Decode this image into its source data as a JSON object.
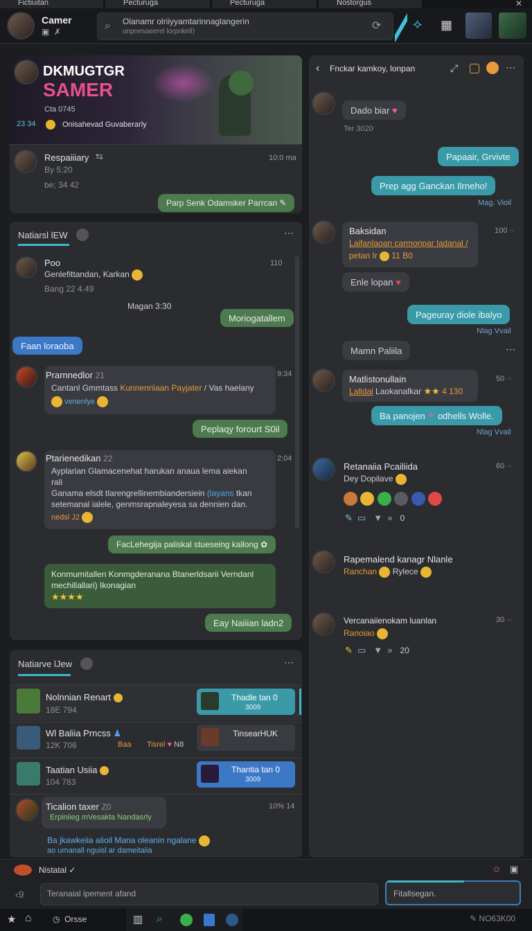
{
  "tabs": [
    "Fictiuitan",
    "Pecturuga",
    "Pecturuga",
    "Nostorgus"
  ],
  "header": {
    "username": "Camer",
    "search_text": "Olanamr olriiyyamtarinnaglangerin",
    "search_sub": "unpnesaeerel lorpnkell)"
  },
  "hero": {
    "title_line1": "DKMUGTGR",
    "title_line2": "SAMER",
    "stat1": "Cta  0745",
    "level": "23 34",
    "tagline": "Onisahevad Guvaberarly",
    "post_name": "Respaiiiary",
    "post_sub1": "By 5:20",
    "post_sub2": "be; 34 42",
    "post_time": "10:0 ma",
    "post_bubble": "Parp Senk Odamsker Parrcan"
  },
  "chat1": {
    "tab_label": "Natiarsl lEW",
    "messages": [
      {
        "name": "Poo",
        "text": "Genlefittandan, Karkan",
        "sub": "Bang 22 4.49",
        "time": "110"
      },
      {
        "divider": "Magan 3:30"
      },
      {
        "bubble_right": "Moriogatallem"
      },
      {
        "bubble_left": "Faan loraoba"
      },
      {
        "name": "Prarnnedlor",
        "badge": "21",
        "text_a": "Cantanl Gmmtass",
        "text_link": "Kunnenriiaan Payjater",
        "text_b": "/ Vas haelany",
        "text_c": "venenlye",
        "time": "9:34"
      },
      {
        "bubble_right": "Peplaqy forourt S0il"
      },
      {
        "name": "Ptarienedikan",
        "badge": "22",
        "line1": "Ayplarian Glamacenehat harukan anaua lema aiekan",
        "line2": "rali",
        "line3": "Ganama elsdt tlarengrellinembiandersiein",
        "line3_link": "(layans",
        "line3_b": "tkan",
        "line4": "setemanal ialele, genmsrapnaleyesa sa dennien dan.",
        "line5": "nedsl J2",
        "time": "2:04"
      },
      {
        "bubble_right": "FacLehegija paliskal stueseing kallong"
      },
      {
        "card_line1": "Konmumitallen Konmgderanana Btanerldsarii Verndanl",
        "card_line2": "mechillallari) Ikonagian"
      },
      {
        "bubble_right": "Eay Naiiian ladn2"
      }
    ]
  },
  "list_panel": {
    "tab_label": "Natiarve lJew",
    "rows": [
      {
        "title": "Nolnnian Renart",
        "sub": "18E 794",
        "card_title": "Thadle tan 0",
        "card_sub": "3009"
      },
      {
        "title": "Wl Baliia Prncss",
        "sub": "12K 706",
        "extra_a": "Baa",
        "extra_b": "Tisrel",
        "extra_c": "N8",
        "card_title": "TinsearHUK"
      },
      {
        "title": "Taatian Usiia",
        "sub": "104 783",
        "card_title": "Thantia tan 0",
        "card_sub": "3009"
      },
      {
        "title": "Ticalion taxer",
        "badge": "Z0",
        "sub": "Erpiniieg mVesakta Nandasrly",
        "time": "10% 14",
        "note1": "Ba jkawkeiia alioil Mana oleanin ngalane",
        "note2": "ao umanall nguisl ar dameitaiia"
      }
    ]
  },
  "right": {
    "header": "Fnckar kamkoy, lonpan",
    "messages": [
      {
        "bubble": "Dado biar",
        "sub": "Ter 3020"
      },
      {
        "bubble_right": "Papaair, Grvivte"
      },
      {
        "bubble_right": "Prep agg Ganckan Ilrneho!",
        "sub": "Mag. Vioil"
      },
      {
        "name": "Baksidan",
        "link": "Laifanlaoan carmonpar ladanal /",
        "link2": "petan Ir",
        "extra": "11 B0",
        "time": "100"
      },
      {
        "bubble": "Enle lopan"
      },
      {
        "bubble_right": "Pageuray diole ibalyo",
        "sub": "Nlag Vvail"
      },
      {
        "bubble": "Mamn Paliila"
      },
      {
        "name": "Matlistonullain",
        "link": "Lalldal",
        "text": "Laokanafkar",
        "extra": "4 130",
        "time": "50"
      },
      {
        "bubble_right": "Ba panojen",
        "bubble_right_b": "odhells Wolle.",
        "sub": "Nlag Vvail"
      },
      {
        "name": "Retanaiia Pcailiida",
        "sub_text": "Dey Dopilave",
        "time": "60",
        "count": "0"
      },
      {
        "name": "Rapemalend kanagr Nlanle",
        "text": "Ranchan",
        "text_b": "Rylece"
      },
      {
        "name": "Vercanaiienokam luanlan",
        "text": "Ranoiao",
        "time": "30",
        "count": "20"
      }
    ]
  },
  "composer": {
    "label": "Nistatal",
    "input_placeholder": "Teranaial ipement afand",
    "send_placeholder": "Fitallsegan."
  },
  "taskbar": {
    "item": "Orsse",
    "right_text": "NO63K00"
  }
}
